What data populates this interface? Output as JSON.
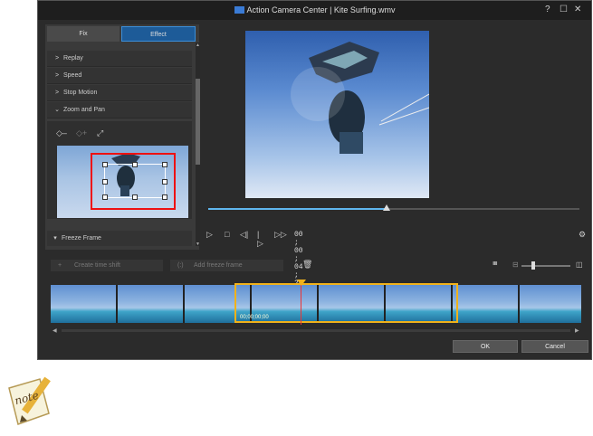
{
  "titlebar": {
    "title": "Action Camera Center | Kite Surfing.wmv",
    "help": "?",
    "maximize": "☐",
    "close": "✕"
  },
  "tabs": {
    "fix": "Fix",
    "effect": "Effect"
  },
  "effects": {
    "items": [
      {
        "label": "Replay",
        "chevron": ">"
      },
      {
        "label": "Speed",
        "chevron": ">"
      },
      {
        "label": "Stop Motion",
        "chevron": ">"
      },
      {
        "label": "Zoom and Pan",
        "chevron": "⌄"
      }
    ],
    "freeze": {
      "label": "Freeze Frame",
      "chevron": "▾"
    }
  },
  "zoom_icons": {
    "remove_keyframe": "◇–",
    "add_keyframe": "◇+",
    "fit": "⤢"
  },
  "player": {
    "timecode": "00 ; 00 ; 04 ; 26",
    "progress": 0.48,
    "play": "▷",
    "stop": "□",
    "prev_frame": "◁|",
    "next_frame": "|▷",
    "fast_forward": "▷▷",
    "settings": "⚙"
  },
  "timeline": {
    "create_time_shift": "Create time shift",
    "add_freeze_frame": "Add freeze frame",
    "create_icon": "+",
    "freeze_icon": "(:)",
    "delete_icon": "🗑",
    "timecode_badge": "00;00;00;00"
  },
  "zoom_slider": {
    "split_icon": "ııııı",
    "min_icon": "⊟",
    "max_icon": "◫",
    "level": 0.2
  },
  "filmstrip_frames": 8,
  "buttons": {
    "ok": "OK",
    "cancel": "Cancel"
  },
  "scroll_arrows": {
    "left": "◀",
    "right": "▶",
    "up": "▲",
    "down": "▼"
  },
  "note_badge": "note",
  "colors": {
    "accent": "#1d5b98",
    "selection": "#f1b21a",
    "playhead": "#e33333",
    "highlight": "#e11111"
  }
}
